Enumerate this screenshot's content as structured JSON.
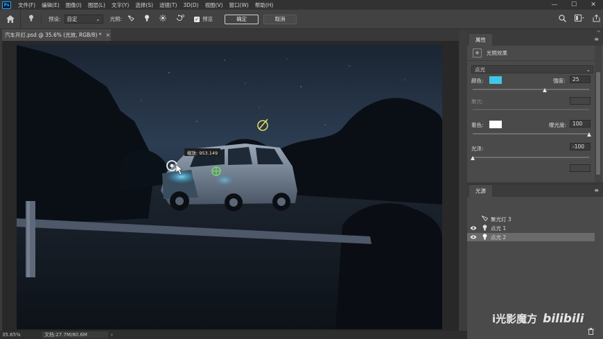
{
  "menu": {
    "logo": "Ps",
    "items": [
      "文件(F)",
      "编辑(E)",
      "图像(I)",
      "图层(L)",
      "文字(Y)",
      "选择(S)",
      "滤镜(T)",
      "3D(D)",
      "视图(V)",
      "窗口(W)",
      "帮助(H)"
    ]
  },
  "window_controls": [
    "—",
    "☐",
    "✕"
  ],
  "options": {
    "preset_label": "预设:",
    "preset_value": "自定",
    "light_label": "光照:",
    "preview_label": "预览",
    "ok_label": "确定",
    "cancel_label": "取消"
  },
  "document": {
    "tab_title": "汽车开灯.psd @ 35.6% (光效, RGB/8) *",
    "close": "×"
  },
  "canvas": {
    "tooltip": "缩放: 953.149"
  },
  "status": {
    "zoom": "35.65%",
    "doc_info": "文档:27.7M/80.6M",
    "arrow": "›"
  },
  "properties": {
    "tab": "属性",
    "header": "光照效果",
    "light_type": "点光",
    "color_label": "颜色:",
    "color_value": "#42c6e8",
    "intensity_label": "强度:",
    "intensity_value": "25",
    "intensity_fraction": 0.62,
    "hotspot_label": "聚光:",
    "colorize_label": "着色:",
    "colorize_value": "#ffffff",
    "exposure_label": "曝光度:",
    "exposure_value": "100",
    "exposure_fraction": 1.0,
    "gloss_label": "光泽:",
    "gloss_value": "-100",
    "gloss_fraction": 0.0
  },
  "lights_panel": {
    "tab": "光源",
    "items": [
      {
        "name": "聚光灯 3",
        "visible": false,
        "selected": false
      },
      {
        "name": "点光 1",
        "visible": true,
        "selected": false
      },
      {
        "name": "点光 2",
        "visible": true,
        "selected": true
      }
    ]
  },
  "watermark": {
    "text": "i光影魔方",
    "brand": "bilibili"
  }
}
